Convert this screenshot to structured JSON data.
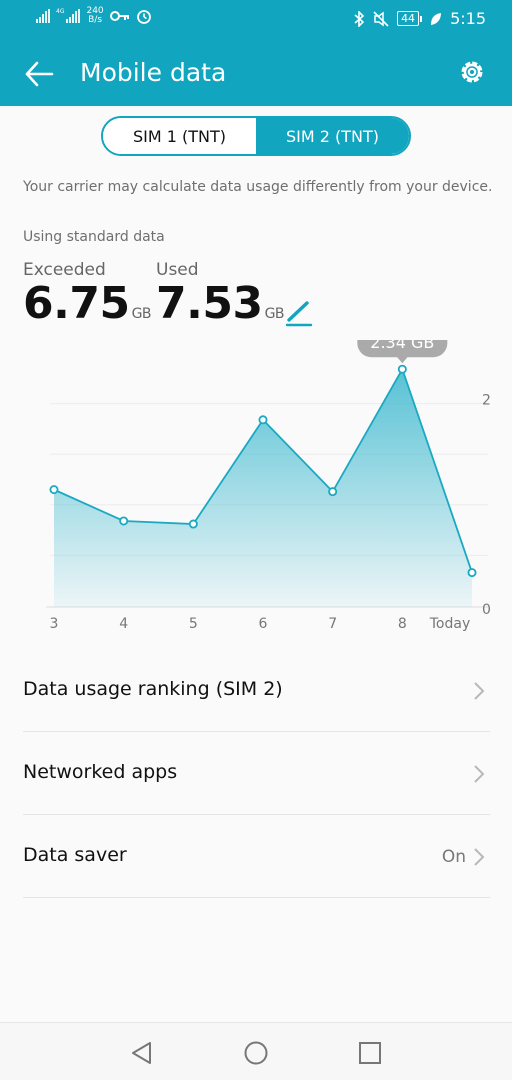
{
  "status_bar": {
    "network_label": "4G",
    "speed_value": "240",
    "speed_unit": "B/s",
    "battery": "44",
    "time": "5:15"
  },
  "toolbar": {
    "title": "Mobile data",
    "back_icon": "arrow-left-icon",
    "settings_icon": "gear-icon"
  },
  "sim_tabs": [
    {
      "label": "SIM 1 (TNT)",
      "selected": false
    },
    {
      "label": "SIM 2 (TNT)",
      "selected": true
    }
  ],
  "carrier_note": "Your carrier may calculate data usage differently from your device.",
  "plan_label": "Using standard data",
  "stats": {
    "exceeded": {
      "label": "Exceeded",
      "value": "6.75",
      "unit": "GB"
    },
    "used": {
      "label": "Used",
      "value": "7.53",
      "unit": "GB"
    }
  },
  "chart_data": {
    "type": "area",
    "categories": [
      "3",
      "4",
      "5",
      "6",
      "7",
      "8",
      "Today"
    ],
    "values": [
      1.15,
      0.84,
      0.81,
      1.84,
      1.13,
      2.34,
      0.33
    ],
    "y_tick_labels": [
      "2",
      "0"
    ],
    "ylim": [
      0,
      2.5
    ],
    "tooltip": "2.34 GB",
    "grid": true,
    "colors": {
      "line": "#1aa9c2",
      "fill": "#4fbfd3"
    }
  },
  "list": [
    {
      "label": "Data usage ranking (SIM 2)",
      "value": ""
    },
    {
      "label": "Networked apps",
      "value": ""
    },
    {
      "label": "Data saver",
      "value": "On"
    }
  ],
  "nav_bar": [
    "back-triangle-icon",
    "home-circle-icon",
    "recents-square-icon"
  ],
  "colors": {
    "accent": "#12a5bf"
  }
}
